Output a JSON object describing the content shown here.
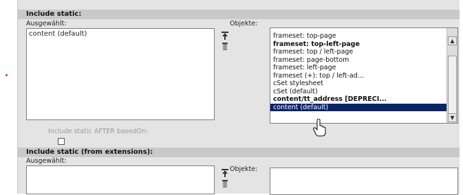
{
  "section1": {
    "title": "Include static:",
    "selected_label": "Ausgewählt:",
    "objects_label": "Objekte:",
    "selected_items": [
      "content (default)"
    ],
    "objects": [
      {
        "label": "frameset: top-page",
        "bold": false,
        "selected": false
      },
      {
        "label": "frameset: top-left-page",
        "bold": true,
        "selected": false
      },
      {
        "label": "frameset: top / left-page",
        "bold": false,
        "selected": false
      },
      {
        "label": "frameset: page-bottom",
        "bold": false,
        "selected": false
      },
      {
        "label": "frameset: left-page",
        "bold": false,
        "selected": false
      },
      {
        "label": "frameset (+): top / left-ad...",
        "bold": false,
        "selected": false
      },
      {
        "label": "cSet stylesheet",
        "bold": false,
        "selected": false
      },
      {
        "label": "cSet (default)",
        "bold": false,
        "selected": false
      },
      {
        "label": "content/tt_address [DEPRECI...",
        "bold": true,
        "selected": false
      },
      {
        "label": "content (default)",
        "bold": false,
        "selected": true
      }
    ],
    "after_basedon_label": "Include static AFTER basedOn:"
  },
  "section2": {
    "title": "Include static (from extensions):",
    "selected_label": "Ausgewählt:",
    "objects_label": "Objekte:"
  },
  "icons": {
    "move_top": "move-top-icon",
    "remove": "trash-icon",
    "scroll_up": "scroll-up-arrow-icon",
    "scroll_down": "scroll-down-arrow-icon",
    "cursor": "hand-cursor-icon"
  }
}
